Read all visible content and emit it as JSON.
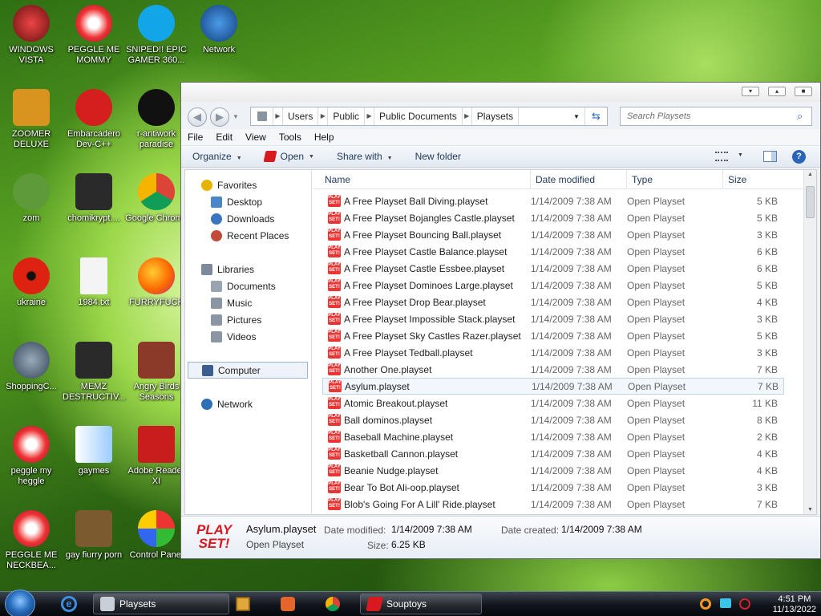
{
  "desktop": {
    "icons": [
      {
        "label": "WINDOWS VISTA",
        "icon": "toaster-icon"
      },
      {
        "label": "PEGGLE ME MOMMY",
        "icon": "peggle-icon"
      },
      {
        "label": "SNIPED!! EPIC GAMER 360...",
        "icon": "skype-icon"
      },
      {
        "label": "Network",
        "icon": "network-icon"
      },
      {
        "label": "ZOOMER DELUXE",
        "icon": "zoomer-icon"
      },
      {
        "label": "Embarcadero Dev-C++",
        "icon": "devcpp-icon"
      },
      {
        "label": "r-antiwork paradise",
        "icon": "reddit-icon"
      },
      {
        "label": "zom",
        "icon": "zombie-icon"
      },
      {
        "label": "chomikrypt....",
        "icon": "lock-icon"
      },
      {
        "label": "Google Chrome",
        "icon": "chrome-icon"
      },
      {
        "label": "ukraine",
        "icon": "radiation-icon"
      },
      {
        "label": "1984.txt",
        "icon": "text-file-icon"
      },
      {
        "label": "FURRYFUCK",
        "icon": "firefox-icon"
      },
      {
        "label": "ShoppingC...",
        "icon": "flash-icon"
      },
      {
        "label": "MEMZ DESTRUCTIV...",
        "icon": "lock-icon"
      },
      {
        "label": "Angry Birds Seasons",
        "icon": "angry-birds-icon"
      },
      {
        "label": "peggle my heggle",
        "icon": "peggle-icon"
      },
      {
        "label": "gaymes",
        "icon": "games-icon"
      },
      {
        "label": "Adobe Reader XI",
        "icon": "adobe-reader-icon"
      },
      {
        "label": "PEGGLE ME NECKBEA...",
        "icon": "peggle-icon"
      },
      {
        "label": "gay fiurry porn",
        "icon": "box-icon"
      },
      {
        "label": "Control Panel",
        "icon": "control-panel-icon"
      }
    ]
  },
  "explorer": {
    "breadcrumbs": [
      "Users",
      "Public",
      "Public Documents",
      "Playsets"
    ],
    "search_placeholder": "Search Playsets",
    "menu": [
      "File",
      "Edit",
      "View",
      "Tools",
      "Help"
    ],
    "commands": {
      "organize": "Organize",
      "open": "Open",
      "share": "Share with",
      "new_folder": "New folder"
    },
    "nav": {
      "favorites": "Favorites",
      "favorites_items": [
        "Desktop",
        "Downloads",
        "Recent Places"
      ],
      "libraries": "Libraries",
      "libraries_items": [
        "Documents",
        "Music",
        "Pictures",
        "Videos"
      ],
      "computer": "Computer",
      "network": "Network"
    },
    "columns": {
      "name": "Name",
      "date": "Date modified",
      "type": "Type",
      "size": "Size"
    },
    "files": [
      {
        "name": "A Free Playset Ball Diving.playset",
        "date": "1/14/2009 7:38 AM",
        "type": "Open Playset",
        "size": "5 KB"
      },
      {
        "name": "A Free Playset Bojangles Castle.playset",
        "date": "1/14/2009 7:38 AM",
        "type": "Open Playset",
        "size": "5 KB"
      },
      {
        "name": "A Free Playset Bouncing Ball.playset",
        "date": "1/14/2009 7:38 AM",
        "type": "Open Playset",
        "size": "3 KB"
      },
      {
        "name": "A Free Playset Castle Balance.playset",
        "date": "1/14/2009 7:38 AM",
        "type": "Open Playset",
        "size": "6 KB"
      },
      {
        "name": "A Free Playset Castle Essbee.playset",
        "date": "1/14/2009 7:38 AM",
        "type": "Open Playset",
        "size": "6 KB"
      },
      {
        "name": "A Free Playset Dominoes Large.playset",
        "date": "1/14/2009 7:38 AM",
        "type": "Open Playset",
        "size": "5 KB"
      },
      {
        "name": "A Free Playset Drop Bear.playset",
        "date": "1/14/2009 7:38 AM",
        "type": "Open Playset",
        "size": "4 KB"
      },
      {
        "name": "A Free Playset Impossible Stack.playset",
        "date": "1/14/2009 7:38 AM",
        "type": "Open Playset",
        "size": "3 KB"
      },
      {
        "name": "A Free Playset Sky Castles Razer.playset",
        "date": "1/14/2009 7:38 AM",
        "type": "Open Playset",
        "size": "5 KB"
      },
      {
        "name": "A Free Playset Tedball.playset",
        "date": "1/14/2009 7:38 AM",
        "type": "Open Playset",
        "size": "3 KB"
      },
      {
        "name": "Another One.playset",
        "date": "1/14/2009 7:38 AM",
        "type": "Open Playset",
        "size": "7 KB"
      },
      {
        "name": "Asylum.playset",
        "date": "1/14/2009 7:38 AM",
        "type": "Open Playset",
        "size": "7 KB"
      },
      {
        "name": "Atomic Breakout.playset",
        "date": "1/14/2009 7:38 AM",
        "type": "Open Playset",
        "size": "11 KB"
      },
      {
        "name": "Ball dominos.playset",
        "date": "1/14/2009 7:38 AM",
        "type": "Open Playset",
        "size": "8 KB"
      },
      {
        "name": "Baseball Machine.playset",
        "date": "1/14/2009 7:38 AM",
        "type": "Open Playset",
        "size": "2 KB"
      },
      {
        "name": "Basketball Cannon.playset",
        "date": "1/14/2009 7:38 AM",
        "type": "Open Playset",
        "size": "4 KB"
      },
      {
        "name": "Beanie Nudge.playset",
        "date": "1/14/2009 7:38 AM",
        "type": "Open Playset",
        "size": "4 KB"
      },
      {
        "name": "Bear To Bot Ali-oop.playset",
        "date": "1/14/2009 7:38 AM",
        "type": "Open Playset",
        "size": "3 KB"
      },
      {
        "name": "Blob's Going For A Lill' Ride.playset",
        "date": "1/14/2009 7:38 AM",
        "type": "Open Playset",
        "size": "7 KB"
      }
    ],
    "selected_index": 11,
    "details": {
      "name": "Asylum.playset",
      "type": "Open Playset",
      "date_modified_label": "Date modified:",
      "date_modified": "1/14/2009 7:38 AM",
      "date_created_label": "Date created:",
      "date_created": "1/14/2009 7:38 AM",
      "size_label": "Size:",
      "size": "6.25 KB",
      "icon_text": "PLAY SET!"
    }
  },
  "taskbar": {
    "buttons": [
      {
        "label": "Playsets"
      },
      {
        "label": "Souptoys"
      }
    ],
    "time": "4:51 PM",
    "date": "11/13/2022"
  },
  "colors": {
    "playset_red": "#d71920",
    "selection": "#f2f7fd"
  }
}
